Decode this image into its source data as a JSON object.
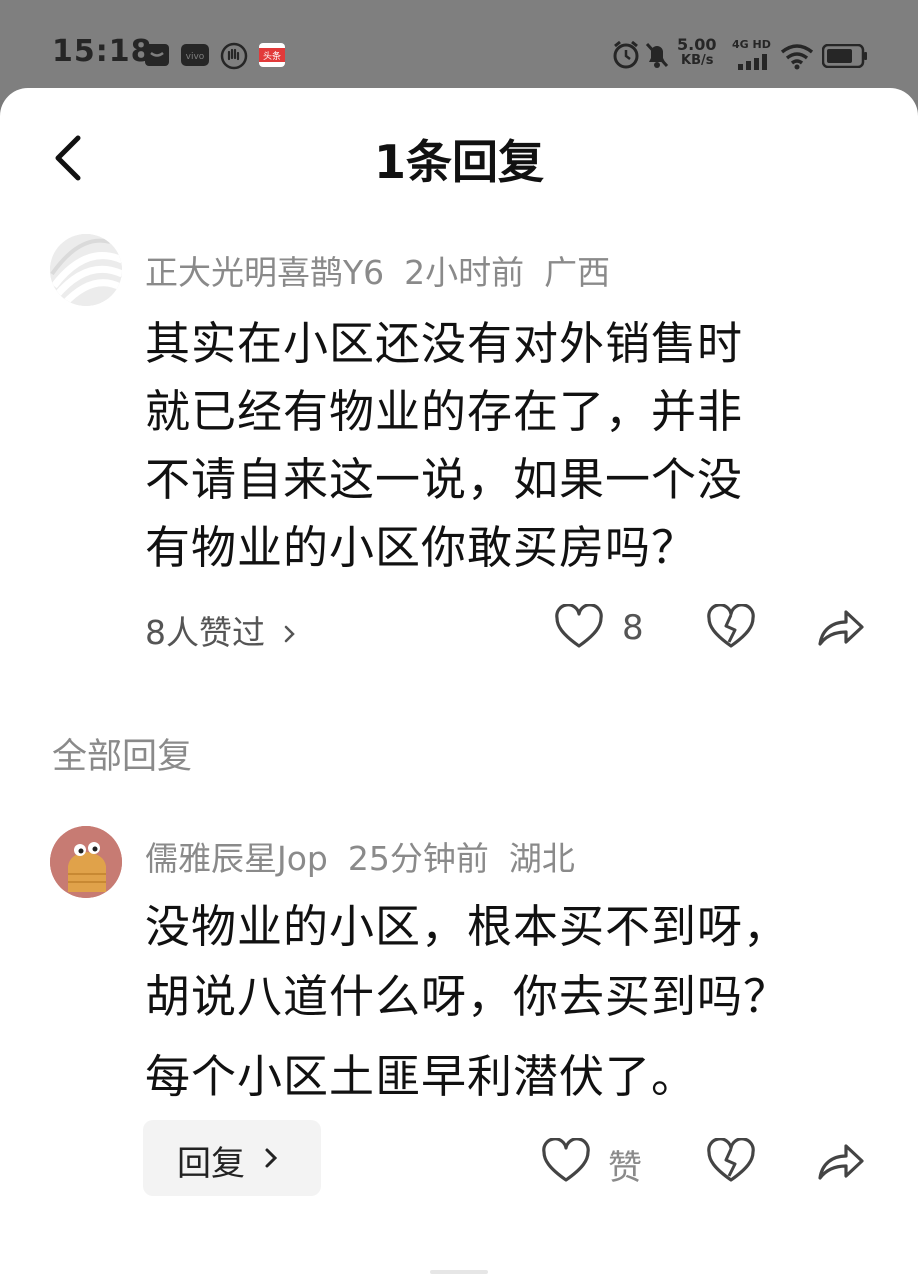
{
  "status_bar": {
    "time": "15:18",
    "net_speed": "5.00",
    "net_unit": "KB/s",
    "net_type": "4G HD",
    "app_badge": "头条",
    "icons": [
      "message-icon",
      "vivo-icon",
      "hand-icon",
      "toutiao-app-icon",
      "alarm-icon",
      "mute-icon",
      "signal-icon",
      "wifi-icon",
      "battery-icon"
    ]
  },
  "header": {
    "title": "1条回复"
  },
  "main_comment": {
    "username": "正大光明喜鹊Y6",
    "time": "2小时前",
    "location": "广西",
    "lines": [
      "其实在小区还没有对外销售时",
      "就已经有物业的存在了，并非",
      "不请自来这一说，如果一个没",
      "有物业的小区你敢买房吗？"
    ],
    "likes_summary": "8人赞过",
    "like_count": "8"
  },
  "section": {
    "label": "全部回复"
  },
  "reply": {
    "username": "儒雅辰星Jop",
    "time": "25分钟前",
    "location": "湖北",
    "lines": [
      "没物业的小区，根本买不到呀，",
      "胡说八道什么呀，你去买到吗？",
      "每个小区土匪早利潜伏了。"
    ],
    "reply_label": "回复",
    "like_label": "赞"
  },
  "colors": {
    "status_bg": "#7f7f7f",
    "sheet_bg": "#ffffff",
    "text_primary": "#111111",
    "text_secondary": "#8a8a8a",
    "reply_btn_bg": "#f3f3f3",
    "reply_avatar_bg": "#c77b73"
  }
}
